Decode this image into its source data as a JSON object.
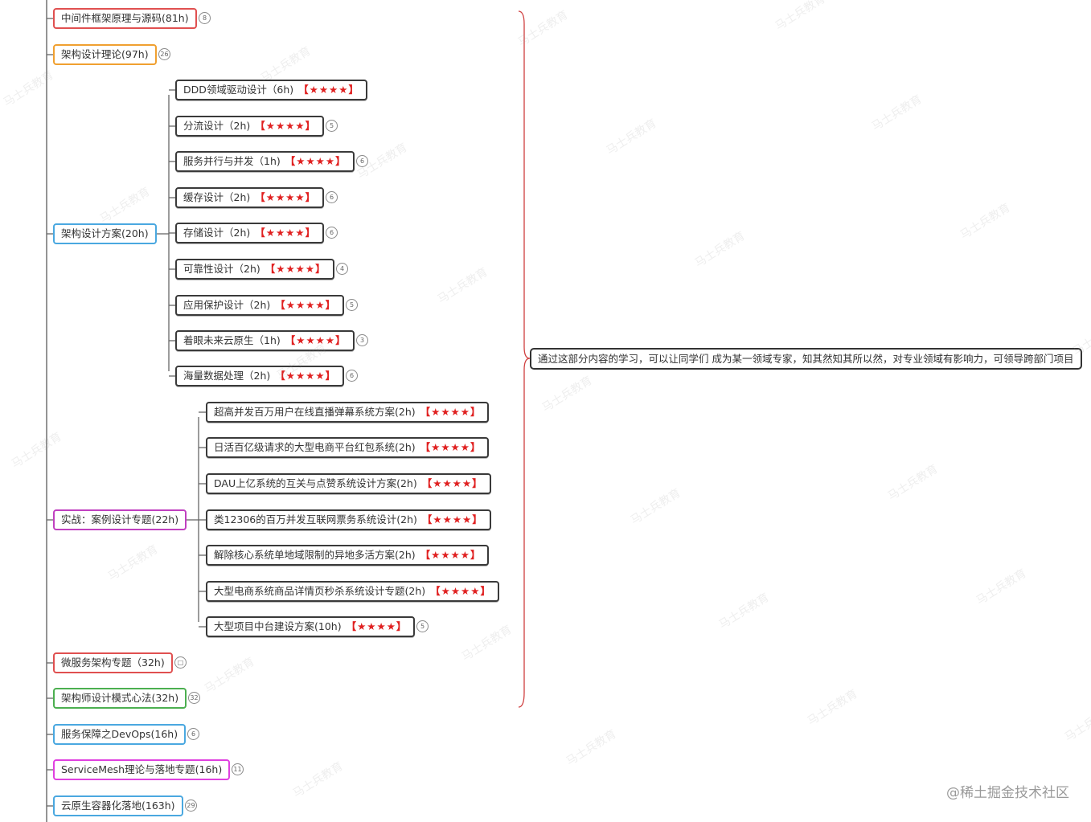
{
  "top_nodes": [
    {
      "label": "中间件框架原理与源码(81h)",
      "badge": "8",
      "color": "#e05050"
    },
    {
      "label": "架构设计理论(97h)",
      "badge": "26",
      "color": "#f0a030"
    },
    {
      "label": "架构设计方案(20h)",
      "badge": "",
      "color": "#4aa8e0"
    },
    {
      "label": "实战：案例设计专题(22h)",
      "badge": "",
      "color": "#c040c0"
    },
    {
      "label": "微服务架构专题（32h)",
      "badge": "□",
      "color": "#e05050"
    },
    {
      "label": "架构师设计模式心法(32h)",
      "badge": "32",
      "color": "#4caf50"
    },
    {
      "label": "服务保障之DevOps(16h)",
      "badge": "6",
      "color": "#4aa8e0"
    },
    {
      "label": "ServiceMesh理论与落地专题(16h)",
      "badge": "11",
      "color": "#e040e0"
    },
    {
      "label": "云原生容器化落地(163h)",
      "badge": "29",
      "color": "#4aa8e0"
    }
  ],
  "design_children": [
    {
      "label": "DDD领域驱动设计（6h)",
      "stars": "【★★★★】",
      "badge": ""
    },
    {
      "label": "分流设计（2h)",
      "stars": "【★★★★】",
      "badge": "5"
    },
    {
      "label": "服务并行与并发（1h)",
      "stars": "【★★★★】",
      "badge": "6"
    },
    {
      "label": "缓存设计（2h)",
      "stars": "【★★★★】",
      "badge": "6"
    },
    {
      "label": "存储设计（2h)",
      "stars": "【★★★★】",
      "badge": "6"
    },
    {
      "label": "可靠性设计（2h)",
      "stars": "【★★★★】",
      "badge": "4"
    },
    {
      "label": "应用保护设计（2h)",
      "stars": "【★★★★】",
      "badge": "5"
    },
    {
      "label": "着眼未来云原生（1h)",
      "stars": "【★★★★】",
      "badge": "3"
    },
    {
      "label": "海量数据处理（2h)",
      "stars": "【★★★★】",
      "badge": "6"
    }
  ],
  "case_children": [
    {
      "label": "超高并发百万用户在线直播弹幕系统方案(2h)",
      "stars": "【★★★★】",
      "badge": ""
    },
    {
      "label": "日活百亿级请求的大型电商平台红包系统(2h)",
      "stars": "【★★★★】",
      "badge": ""
    },
    {
      "label": "DAU上亿系统的互关与点赞系统设计方案(2h)",
      "stars": "【★★★★】",
      "badge": ""
    },
    {
      "label": "类12306的百万并发互联网票务系统设计(2h)",
      "stars": "【★★★★】",
      "badge": ""
    },
    {
      "label": "解除核心系统单地域限制的异地多活方案(2h)",
      "stars": "【★★★★】",
      "badge": ""
    },
    {
      "label": "大型电商系统商品详情页秒杀系统设计专题(2h)",
      "stars": "【★★★★】",
      "badge": ""
    },
    {
      "label": "大型项目中台建设方案(10h)",
      "stars": "【★★★★】",
      "badge": "5"
    }
  ],
  "summary": "通过这部分内容的学习，可以让同学们 成为某一领域专家，知其然知其所以然，对专业领域有影响力，可领导跨部门项目",
  "footer": "@稀土掘金技术社区",
  "watermark": "马士兵教育",
  "colors": {
    "stars": "#e02020",
    "brace": "#d04040",
    "line": "#666666"
  }
}
